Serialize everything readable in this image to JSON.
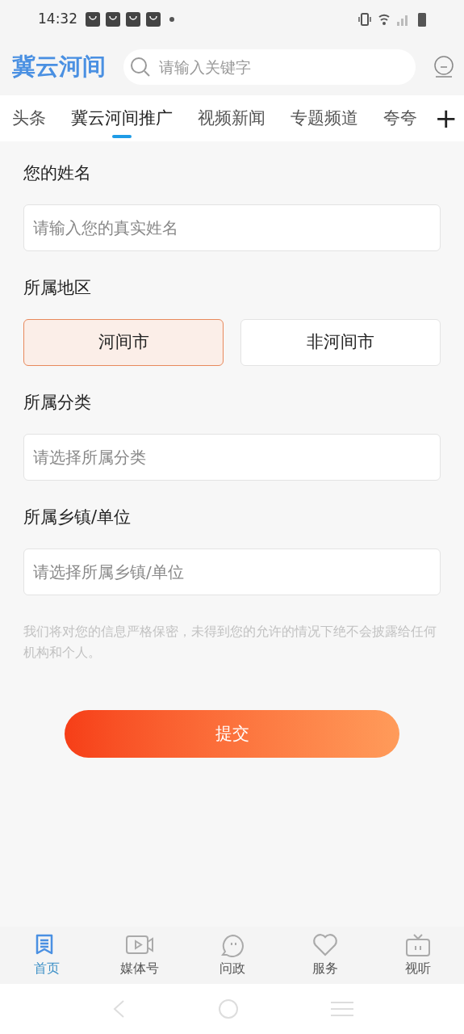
{
  "status_bar": {
    "time": "14:32"
  },
  "header": {
    "logo": "冀云河间",
    "search": {
      "placeholder": "请输入关键字"
    }
  },
  "tabs": [
    {
      "label": "头条",
      "selected": false
    },
    {
      "label": "冀云河间推广",
      "selected": true
    },
    {
      "label": "视频新闻",
      "selected": false
    },
    {
      "label": "专题频道",
      "selected": false
    },
    {
      "label": "夸夸",
      "selected": false
    }
  ],
  "add_tab": "+",
  "form": {
    "fields": [
      {
        "kind": "text",
        "label": "您的姓名",
        "placeholder": "请输入您的真实姓名"
      },
      {
        "kind": "choice",
        "label": "所属地区",
        "options": [
          {
            "label": "河间市",
            "selected": true
          },
          {
            "label": "非河间市",
            "selected": false
          }
        ]
      },
      {
        "kind": "text",
        "label": "所属分类",
        "placeholder": "请选择所属分类"
      },
      {
        "kind": "text",
        "label": "所属乡镇/单位",
        "placeholder": "请选择所属乡镇/单位"
      }
    ],
    "notice": "我们将对您的信息严格保密，未得到您的允许的情况下绝不会披露给任何机构和个人。",
    "submit": "提交"
  },
  "bottom_nav": [
    {
      "label": "首页",
      "selected": true
    },
    {
      "label": "媒体号",
      "selected": false
    },
    {
      "label": "问政",
      "selected": false
    },
    {
      "label": "服务",
      "selected": false
    },
    {
      "label": "视听",
      "selected": false
    }
  ]
}
